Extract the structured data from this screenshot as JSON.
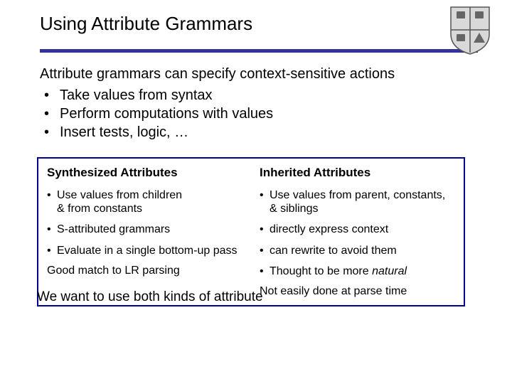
{
  "title": "Using Attribute Grammars",
  "intro": "Attribute grammars can specify context-sensitive actions",
  "bullets": [
    "Take values from syntax",
    "Perform computations with values",
    "Insert tests, logic, …"
  ],
  "left": {
    "heading": "Synthesized Attributes",
    "items": [
      {
        "text": "Use values from children",
        "tail": "& from constants"
      },
      {
        "text": "S-attributed grammars"
      },
      {
        "text": "Evaluate in a single bottom-up pass"
      }
    ],
    "footer": "Good match to LR parsing"
  },
  "right": {
    "heading": "Inherited Attributes",
    "items": [
      {
        "text": "Use values from parent, constants, & siblings"
      },
      {
        "text": "directly express context"
      },
      {
        "text": "can rewrite to avoid them"
      },
      {
        "text_pre": "Thought to be more ",
        "ital": "natural"
      }
    ],
    "footer": "Not easily done at parse time"
  },
  "overlay": "We want to use both kinds of attribute",
  "crest_label": "university-crest"
}
